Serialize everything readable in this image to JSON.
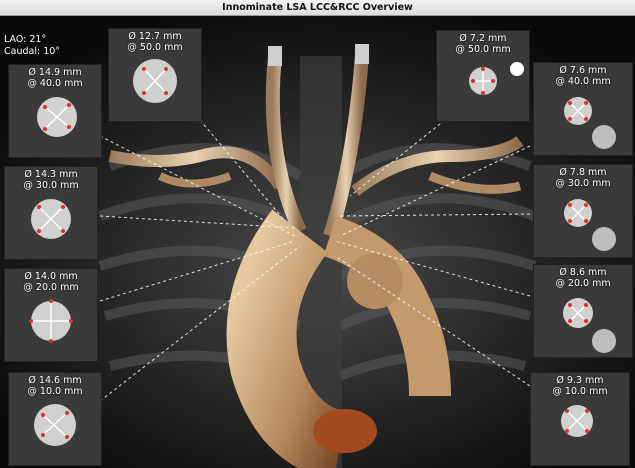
{
  "window": {
    "title": "Innominate LSA LCC&RCC Overview"
  },
  "orientation": {
    "lao": "LAO: 21°",
    "caudal": "Caudal: 10°"
  },
  "insets": {
    "lsa_top": {
      "diameter": "Ø 12.7 mm",
      "position": "@ 50.0 mm"
    },
    "left_40": {
      "diameter": "Ø 14.9 mm",
      "position": "@ 40.0 mm"
    },
    "left_30": {
      "diameter": "Ø 14.3 mm",
      "position": "@ 30.0 mm"
    },
    "left_20": {
      "diameter": "Ø 14.0 mm",
      "position": "@ 20.0 mm"
    },
    "left_10": {
      "diameter": "Ø 14.6 mm",
      "position": "@ 10.0 mm"
    },
    "right_top": {
      "diameter": "Ø 7.2 mm",
      "position": "@ 50.0 mm"
    },
    "right_40": {
      "diameter": "Ø 7.6 mm",
      "position": "@ 40.0 mm"
    },
    "right_30": {
      "diameter": "Ø 7.8 mm",
      "position": "@ 30.0 mm"
    },
    "right_20": {
      "diameter": "Ø 8.6 mm",
      "position": "@ 20.0 mm"
    },
    "right_10": {
      "diameter": "Ø 9.3 mm",
      "position": "@ 10.0 mm"
    }
  },
  "colors": {
    "vessel": "#c9a27a",
    "measure_line": "#ffffff",
    "endpoint": "#e0302a",
    "background": "#0b0b0b"
  }
}
